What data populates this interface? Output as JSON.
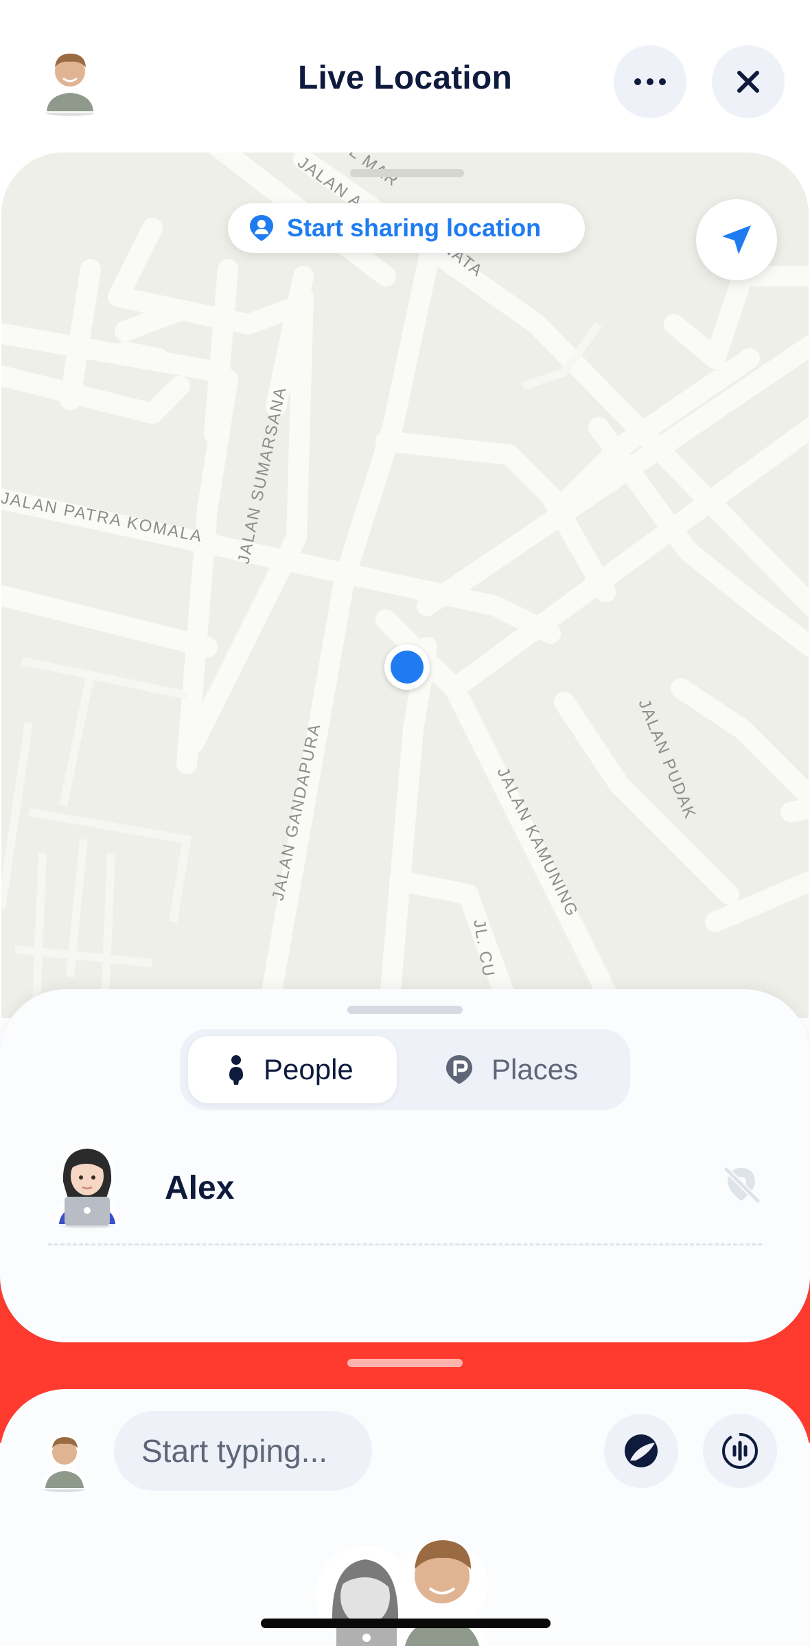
{
  "header": {
    "title": "Live Location",
    "avatar_icon": "user-avatar-photo",
    "more_icon": "ellipsis-icon",
    "close_icon": "close-icon"
  },
  "map": {
    "share_label": "Start sharing location",
    "share_icon": "person-pin-icon",
    "locate_icon": "location-arrow-icon",
    "street_labels": [
      "JALAN PATRA KOMALA",
      "JALAN SUMARSANA",
      "JALAN GANDAPURA",
      "JALAN KAMUNING",
      "JALAN PUDAK",
      "JL. CU",
      "JALAN A",
      "L MAR",
      "NATA"
    ],
    "colors": {
      "background": "#efefe9",
      "street": "#fafaf7",
      "street_label": "#8d8d8d",
      "accent": "#1f7cf0"
    }
  },
  "sheet": {
    "tabs": [
      {
        "label": "People",
        "icon": "person-icon",
        "selected": true
      },
      {
        "label": "Places",
        "icon": "place-pin-icon",
        "selected": false
      }
    ],
    "people": [
      {
        "name": "Alex",
        "avatar": "woman-laptop-emoji",
        "status_icon": "location-hidden-icon"
      }
    ]
  },
  "compose": {
    "placeholder": "Start typing...",
    "draw_icon": "sketch-icon",
    "voice_icon": "voice-icon",
    "stickers": [
      "woman-laptop-sticker",
      "man-photo-sticker"
    ]
  },
  "colors": {
    "primary_text": "#0f1b3d",
    "accent_blue": "#1f7cf0",
    "strip_red": "#ff3b30",
    "button_bg": "#eef1f8"
  }
}
